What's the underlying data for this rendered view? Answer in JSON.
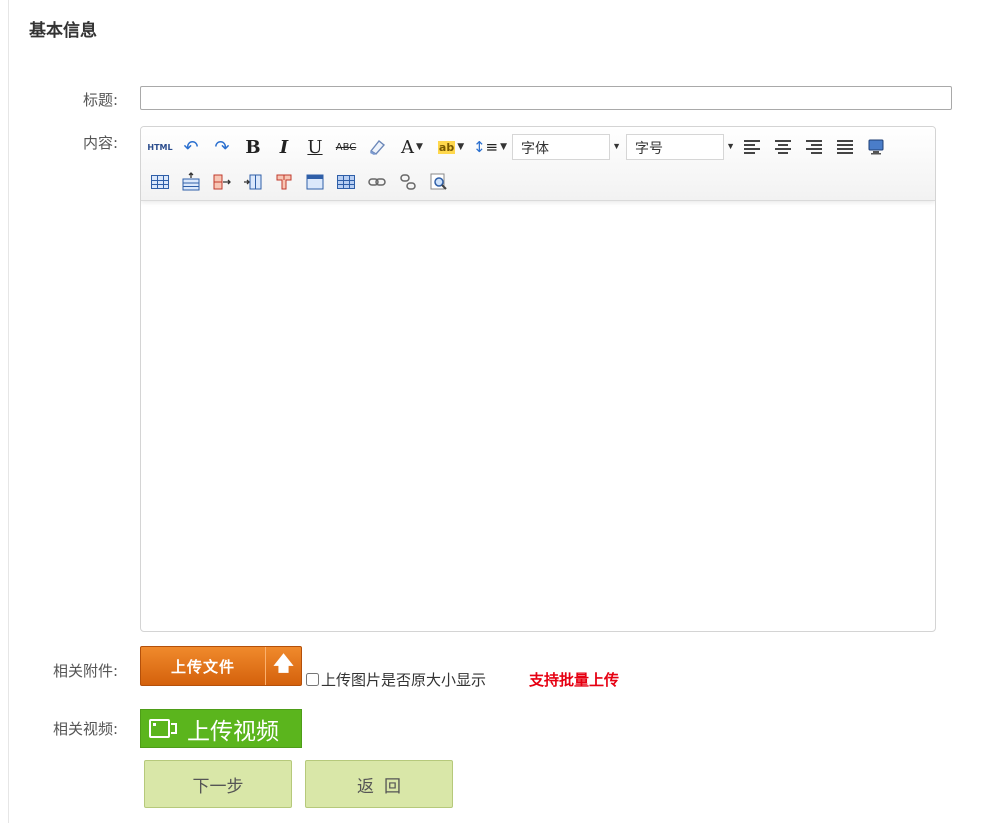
{
  "section": {
    "title": "基本信息"
  },
  "form": {
    "title_label": "标题:",
    "title_value": "",
    "content_label": "内容:",
    "attachment_label": "相关附件:",
    "video_label": "相关视频:"
  },
  "editor": {
    "toolbar_row1": [
      "html-icon",
      "undo-icon",
      "redo-icon",
      "bold-icon",
      "italic-icon",
      "underline-icon",
      "strikethrough-icon",
      "eraser-icon",
      "font-color-icon",
      "highlight-icon",
      "line-height-icon"
    ],
    "html_label": "HTML",
    "bold_label": "B",
    "italic_label": "I",
    "underline_label": "U",
    "strike_label": "ABC",
    "font_color_label": "A",
    "highlight_label": "ab",
    "font_family_placeholder": "字体",
    "font_size_placeholder": "字号",
    "toolbar_row2": [
      "insert-table-icon",
      "insert-row-icon",
      "insert-column-icon",
      "merge-cells-icon",
      "split-cells-icon",
      "table-props-icon",
      "cell-props-icon",
      "link-icon",
      "unlink-icon",
      "preview-icon"
    ],
    "body_text": ""
  },
  "attachment": {
    "upload_label": "上传文件",
    "original_size_label": "上传图片是否原大小显示",
    "original_size_checked": false,
    "batch_note": "支持批量上传",
    "batch_note_color": "#e60012"
  },
  "video": {
    "upload_label": "上传视频"
  },
  "actions": {
    "next_label": "下一步",
    "back_label": "返回"
  },
  "colors": {
    "upload_orange": "#e2731b",
    "video_green": "#5bb51d",
    "action_bg": "#d9e7a8"
  }
}
